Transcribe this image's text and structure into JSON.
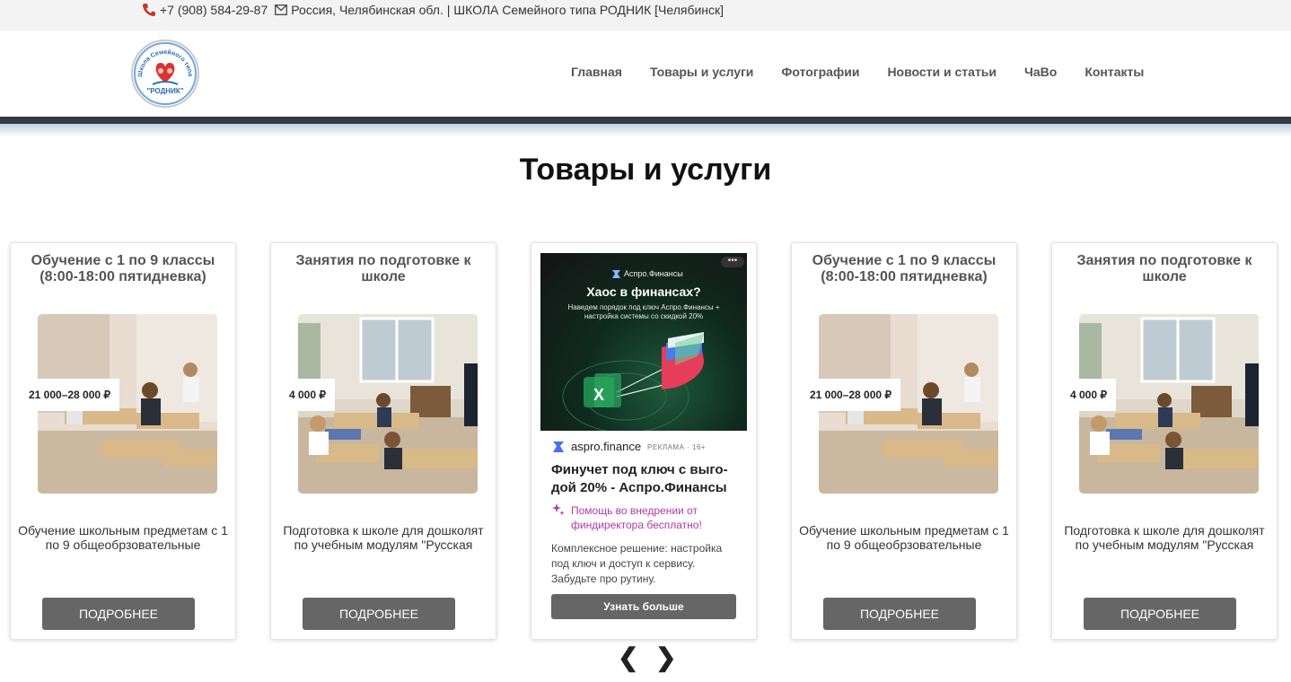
{
  "topbar": {
    "phone": "+7 (908) 584-29-87",
    "address": "Россия, Челябинская обл. | ШКОЛА Семейного типа РОДНИК [Челябинск]"
  },
  "logo": {
    "arc_text": "Школа Семейного типа",
    "name": "\"РОДНИК\""
  },
  "nav": {
    "items": [
      "Главная",
      "Товары и услуги",
      "Фотографии",
      "Новости и статьи",
      "ЧаВо",
      "Контакты"
    ]
  },
  "section": {
    "title": "Товары и услуги"
  },
  "cards": [
    {
      "title": "Обучение с 1 по 9 классы (8:00-18:00 пятидневка)",
      "price": "21 000–28 000 ₽",
      "description": "Обучение школьным предметам с 1 по 9 общеобрзовательные",
      "button": "Подробнее"
    },
    {
      "title": "Занятия по подготовке к школе",
      "price": "4 000 ₽",
      "description": "Подготовка к школе для дошколят по учебным модулям \"Русская",
      "button": "Подробнее"
    },
    {
      "title": "Обучение с 1 по 9 классы (8:00-18:00 пятидневка)",
      "price": "21 000–28 000 ₽",
      "description": "Обучение школьным предметам с 1 по 9 общеобрзовательные",
      "button": "Подробнее"
    },
    {
      "title": "Занятия по подготовке к школе",
      "price": "4 000 ₽",
      "description": "Подготовка к школе для дошколят по учебным модулям \"Русская",
      "button": "Подробнее"
    }
  ],
  "ad": {
    "banner_brand": "Аспро.Финансы",
    "banner_headline": "Хаос в финансах?",
    "banner_sub": "Наведем порядок под ключ Аспро.Финансы + настройка системы со скидкой 20%",
    "more_label": "•••",
    "source": "aspro.finance",
    "mark": "РЕКЛАМА · 16+",
    "title": "Финучет под ключ с выго-дой 20% - Аспро.Финансы",
    "promo": "Помощь во внедрении от финдиректора бесплатно!",
    "text": "Комплексное решение: настройка под ключ и доступ к сервису. Забудьте про рутину.",
    "button": "Узнать больше"
  },
  "carousel": {
    "prev": "❮",
    "next": "❯"
  },
  "colors": {
    "header_bar": "#323a42",
    "button": "#666666",
    "promo": "#b03aa8"
  }
}
